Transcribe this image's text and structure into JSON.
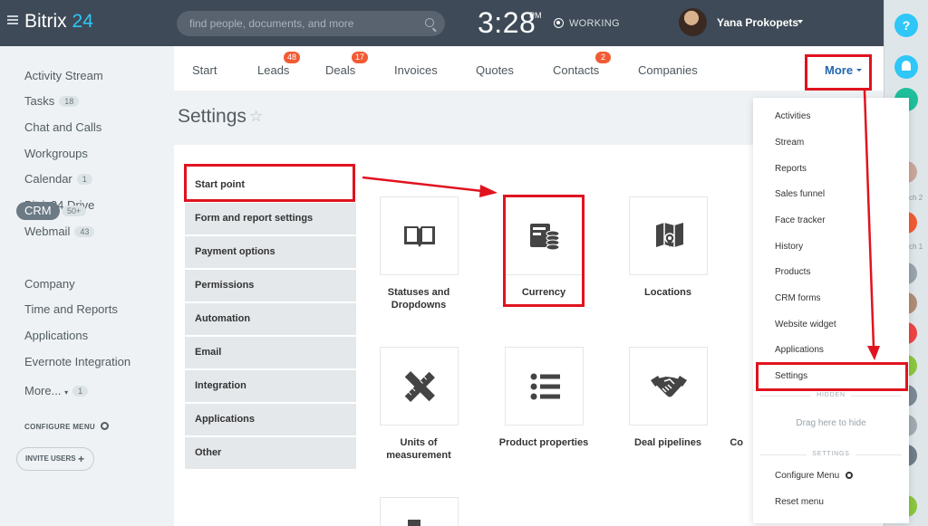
{
  "header": {
    "logo_main": "Bitrix",
    "logo_num": "24",
    "search_placeholder": "find people, documents, and more",
    "clock": "3:28",
    "ampm": "PM",
    "status": "WORKING",
    "user_name": "Yana Prokopets"
  },
  "sidebar": {
    "items": [
      {
        "label": "Activity Stream"
      },
      {
        "label": "Tasks",
        "count": "18"
      },
      {
        "label": "Chat and Calls"
      },
      {
        "label": "Workgroups"
      },
      {
        "label": "Calendar",
        "count": "1"
      },
      {
        "label": "Bitrix24.Drive"
      },
      {
        "label": "Webmail",
        "count": "43"
      },
      {
        "label": "CRM",
        "count": "50+"
      },
      {
        "label": "Company"
      },
      {
        "label": "Time and Reports"
      },
      {
        "label": "Applications"
      },
      {
        "label": "Evernote Integration"
      },
      {
        "label": "More...",
        "count": "1"
      }
    ],
    "configure_menu": "CONFIGURE MENU",
    "invite_users": "INVITE USERS"
  },
  "tabs": [
    {
      "label": "Start"
    },
    {
      "label": "Leads",
      "badge": "48"
    },
    {
      "label": "Deals",
      "badge": "17"
    },
    {
      "label": "Invoices"
    },
    {
      "label": "Quotes"
    },
    {
      "label": "Contacts",
      "badge": "2"
    },
    {
      "label": "Companies"
    },
    {
      "label": "More"
    }
  ],
  "page_title": "Settings",
  "settings_menu": [
    "Start point",
    "Form and report settings",
    "Payment options",
    "Permissions",
    "Automation",
    "Email",
    "Integration",
    "Applications",
    "Other"
  ],
  "tiles": [
    {
      "label_line1": "Statuses and",
      "label_line2": "Dropdowns",
      "icon": "book-icon"
    },
    {
      "label_line1": "Currency",
      "label_line2": "",
      "icon": "currency-icon"
    },
    {
      "label_line1": "Locations",
      "label_line2": "",
      "icon": "map-pin-icon"
    },
    {
      "label_line1": "Units of",
      "label_line2": "measurement",
      "icon": "ruler-pencil-icon"
    },
    {
      "label_line1": "Product properties",
      "label_line2": "",
      "icon": "list-icon"
    },
    {
      "label_line1": "Deal pipelines",
      "label_line2": "",
      "icon": "handshake-icon"
    },
    {
      "label_line1": "Co",
      "label_line2": "",
      "icon": ""
    }
  ],
  "dropdown": {
    "items": [
      "Activities",
      "Stream",
      "Reports",
      "Sales funnel",
      "Face tracker",
      "History",
      "Products",
      "CRM forms",
      "Website widget",
      "Applications",
      "Settings"
    ],
    "hidden_label": "HIDDEN",
    "drag_hint": "Drag here to hide",
    "settings_label": "SETTINGS",
    "configure_menu": "Configure Menu",
    "reset_menu": "Reset menu"
  },
  "right_strip": {
    "help": "?",
    "dates": [
      "arch 2",
      "arch 1"
    ]
  },
  "colors": {
    "topbar": "#3e4a57",
    "accent": "#2fc7f7",
    "badge": "#f25b34",
    "annotation": "#e0131f",
    "link": "#2067b0"
  }
}
